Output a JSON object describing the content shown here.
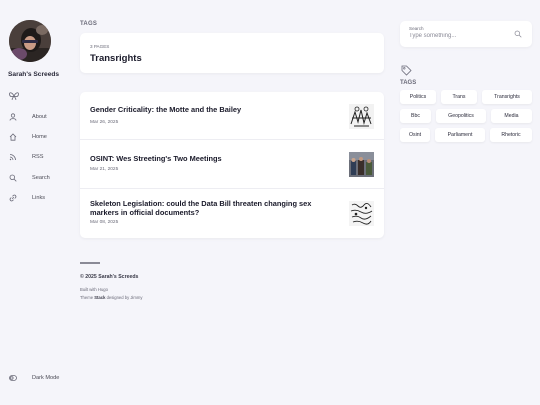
{
  "site": {
    "name": "Sarah's Screeds"
  },
  "nav": {
    "items": [
      {
        "label": "About",
        "icon": "user-icon"
      },
      {
        "label": "Home",
        "icon": "home-icon"
      },
      {
        "label": "RSS",
        "icon": "rss-icon"
      },
      {
        "label": "Search",
        "icon": "search-icon"
      },
      {
        "label": "Links",
        "icon": "link-icon"
      }
    ],
    "dark_mode_label": "Dark Mode"
  },
  "section_label": "TAGS",
  "tag_page": {
    "count": "3 PAGES",
    "title": "Transrights"
  },
  "articles": [
    {
      "title": "Gender Criticality: the Motte and the Bailey",
      "date": "Mar 26, 2025"
    },
    {
      "title": "OSINT: Wes Streeting's Two Meetings",
      "date": "Mar 21, 2025"
    },
    {
      "title": "Skeleton Legislation: could the Data Bill threaten changing sex markers in official documents?",
      "date": "Mar 08, 2025"
    }
  ],
  "footer": {
    "copyright": "© 2025 Sarah's Screeds",
    "built": "Built with Hugo",
    "theme_prefix": "Theme",
    "theme_name": "Stack",
    "theme_suffix": "designed by Jimmy"
  },
  "search": {
    "label": "Search",
    "placeholder": "Type something..."
  },
  "tags_widget": {
    "heading": "TAGS",
    "tags": [
      "Politics",
      "Trans",
      "Transrights",
      "Bbc",
      "Geopolitics",
      "Media",
      "Osint",
      "Parliament",
      "Rhetoric"
    ]
  },
  "colors": {
    "background": "#f5f5fa",
    "card": "#ffffff",
    "text": "#1a1a2a",
    "muted": "#6a6a78"
  }
}
